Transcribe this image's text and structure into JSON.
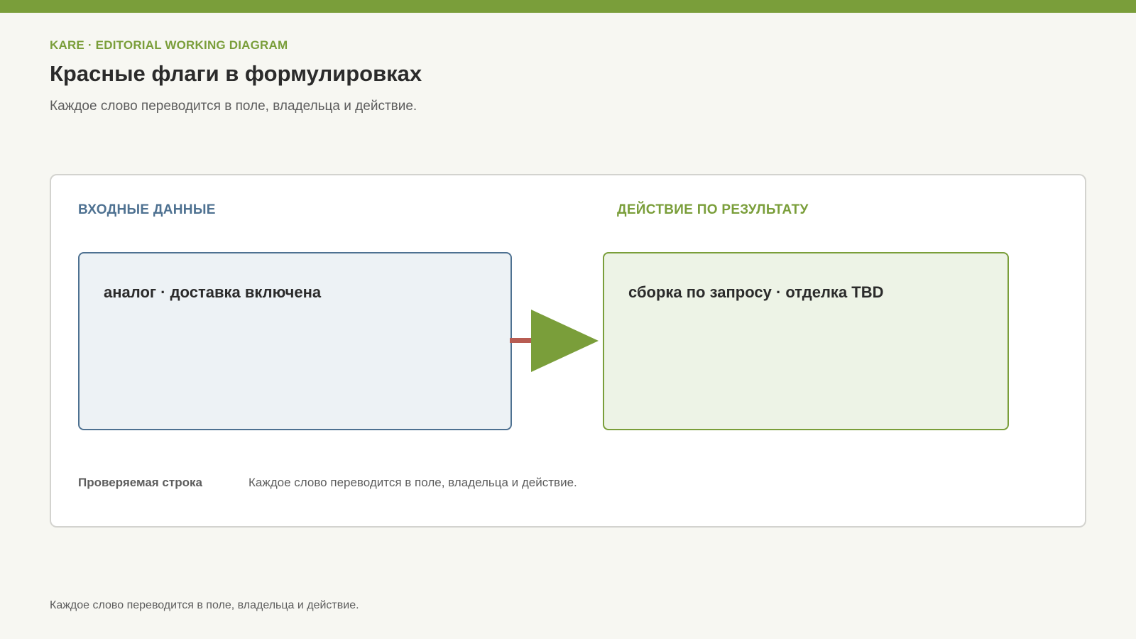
{
  "header": {
    "eyebrow": "KARE · EDITORIAL WORKING DIAGRAM",
    "title": "Красные флаги в формулировках",
    "subtitle": "Каждое слово переводится в поле, владельца и действие."
  },
  "diagram": {
    "input": {
      "label": "ВХОДНЫЕ ДАННЫЕ",
      "text": "аналог · доставка включена"
    },
    "action": {
      "label": "ДЕЙСТВИЕ ПО РЕЗУЛЬТАТУ",
      "text": "сборка по запросу · отделка TBD"
    },
    "check": {
      "label": "Проверяемая строка",
      "value": "Каждое слово переводится в поле, владельца и действие."
    }
  },
  "footer": {
    "note": "Каждое слово переводится в поле, владельца и действие."
  },
  "colors": {
    "accent": "#7a9e3a",
    "input": "#4e7191",
    "connector": "#b85c52",
    "background": "#f7f7f2"
  }
}
